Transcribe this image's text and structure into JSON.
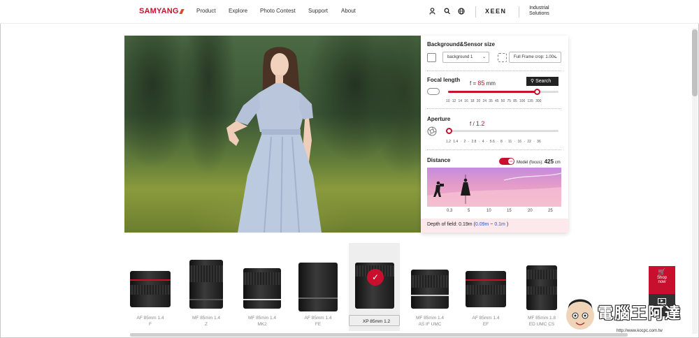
{
  "header": {
    "logo": "SAMYANG",
    "nav": [
      "Product",
      "Explore",
      "Photo Contest",
      "Support",
      "About"
    ],
    "icons": [
      "user-icon",
      "search-icon",
      "globe-icon"
    ],
    "xeen": "XEEN",
    "industrial_line1": "Industrial",
    "industrial_line2": "Solutions"
  },
  "panel": {
    "bg_title": "Background&Sensor size",
    "background_select": "background 1",
    "sensor_select": "Full Frame crop: 1.00x",
    "focal_title": "Focal length",
    "focal_prefix": "f = ",
    "focal_value": "85",
    "focal_unit": " mm",
    "search_label": "Search",
    "focal_ticks": [
      "10",
      "12",
      "14",
      "16",
      "18",
      "20",
      "24",
      "35",
      "45",
      "50",
      "75",
      "85",
      "100",
      "135",
      "300"
    ],
    "focal_fraction": 0.81,
    "aperture_title": "Aperture",
    "aperture_prefix": "f / ",
    "aperture_value": "1.2",
    "aperture_ticks": [
      "1.2",
      "1.4",
      "·",
      "2",
      "·",
      "2.8",
      "·",
      "4",
      "·",
      "5.6",
      "·",
      "8",
      "·",
      "11",
      "·",
      "16",
      "·",
      "22",
      "·",
      "36"
    ],
    "aperture_fraction": 0.0,
    "distance_title": "Distance",
    "toggle_label": "ON",
    "model_focus_label": "Model (focus): ",
    "model_focus_value": "425",
    "model_focus_unit": " cm",
    "distance_ticks": [
      "0.3",
      "5",
      "10",
      "15",
      "20",
      "25"
    ],
    "dof_label": "Depth of field: 0.19m (",
    "dof_near": "0.09m",
    "dof_sep": " ~ ",
    "dof_far": "0.1m",
    "dof_close": " )"
  },
  "lenses": [
    {
      "line1": "AF 85mm 1.4",
      "line2": "F"
    },
    {
      "line1": "MF 85mm 1.4",
      "line2": "Z"
    },
    {
      "line1": "MF 85mm 1.4",
      "line2": "MK2"
    },
    {
      "line1": "AF 85mm 1.4",
      "line2": "FE"
    },
    {
      "line1": "XP 85mm 1.2",
      "line2": ""
    },
    {
      "line1": "MF 85mm 1.4",
      "line2": "AS IF UMC"
    },
    {
      "line1": "AF 85mm 1.4",
      "line2": "EF"
    },
    {
      "line1": "MF 85mm 1.8",
      "line2": "ED UMC CS"
    }
  ],
  "selected_lens": "XP 85mm 1.2",
  "side": {
    "shop_line1": "Shop",
    "shop_line2": "now",
    "tube_label": "Tube"
  },
  "watermark": {
    "text": "電腦王阿達",
    "url": "http://www.kocpc.com.tw"
  },
  "colors": {
    "accent": "#c8102e",
    "dof_blue": "#2a57b8"
  }
}
